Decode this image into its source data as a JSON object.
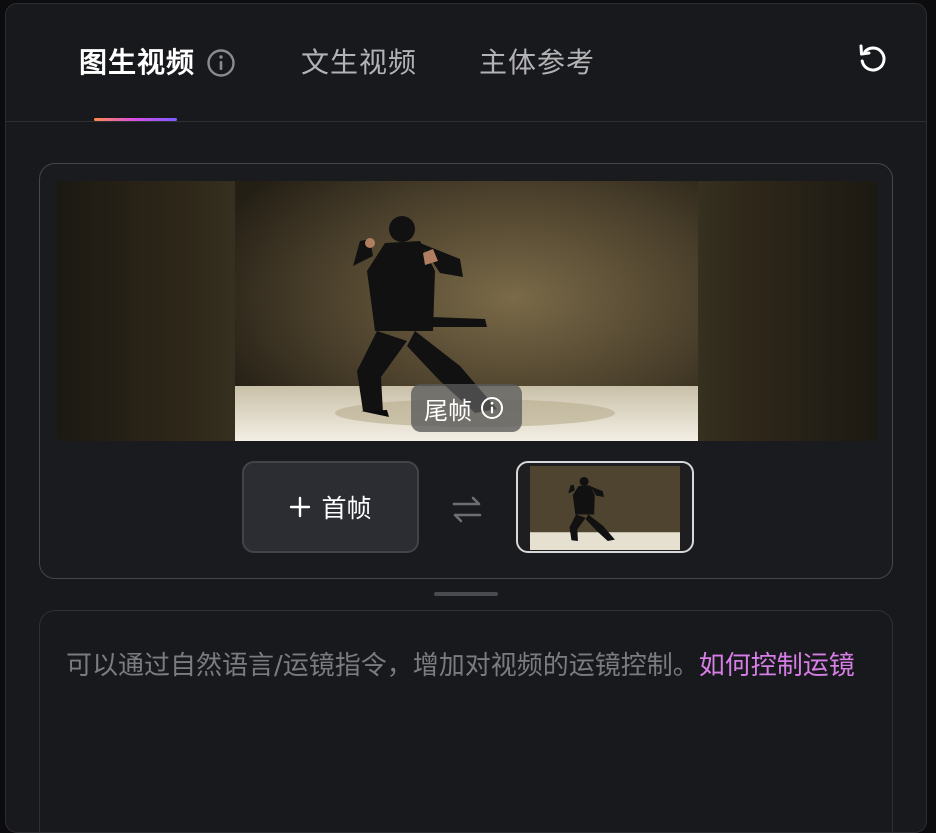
{
  "tabs": [
    {
      "label": "图生视频",
      "active": true
    },
    {
      "label": "文生视频",
      "active": false
    },
    {
      "label": "主体参考",
      "active": false
    }
  ],
  "icons": {
    "tab_info": "info-circle-icon",
    "reset": "refresh-icon",
    "badge_info": "info-circle-icon",
    "add": "plus-icon",
    "swap": "swap-arrows-icon"
  },
  "frames": {
    "tail_badge_label": "尾帧",
    "first_frame_button_label": "首帧"
  },
  "prompt": {
    "placeholder": "可以通过自然语言/运镜指令，增加对视频的运镜控制。",
    "link_text": "如何控制运镜"
  },
  "colors": {
    "accent_gradient": [
      "#ff8a4c",
      "#d74ee6",
      "#7a5cff"
    ],
    "link": "#d77ee6",
    "background": "#18191c"
  }
}
